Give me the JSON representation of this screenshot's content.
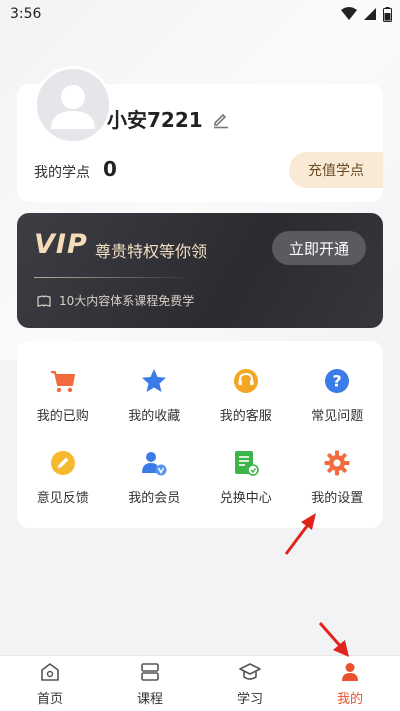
{
  "status_bar": {
    "time": "3:56"
  },
  "profile": {
    "username": "小安7221",
    "points_label": "我的学点",
    "points_value": "0",
    "recharge_label": "充值学点"
  },
  "vip": {
    "logo": "VIP",
    "title": "尊贵特权等你领",
    "subtitle": "10大内容体系课程免费学",
    "button_label": "立即开通"
  },
  "menu": {
    "items": [
      {
        "label": "我的已购",
        "icon": "cart-icon",
        "color": "#f26a3d"
      },
      {
        "label": "我的收藏",
        "icon": "star-icon",
        "color": "#3a7be8"
      },
      {
        "label": "我的客服",
        "icon": "headset-icon",
        "color": "#f5a623"
      },
      {
        "label": "常见问题",
        "icon": "question-icon",
        "color": "#3a7be8"
      },
      {
        "label": "意见反馈",
        "icon": "pencil-icon",
        "color": "#f5b82e"
      },
      {
        "label": "我的会员",
        "icon": "member-icon",
        "color": "#3a7be8"
      },
      {
        "label": "兑换中心",
        "icon": "redeem-icon",
        "color": "#3bb54a"
      },
      {
        "label": "我的设置",
        "icon": "gear-icon",
        "color": "#f26a3d"
      }
    ]
  },
  "tabbar": {
    "items": [
      {
        "label": "首页",
        "icon": "home-icon",
        "active": false
      },
      {
        "label": "课程",
        "icon": "course-icon",
        "active": false
      },
      {
        "label": "学习",
        "icon": "graduation-cap-icon",
        "active": false
      },
      {
        "label": "我的",
        "icon": "user-icon",
        "active": true
      }
    ]
  },
  "colors": {
    "accent": "#e8522c",
    "vip_gold": "#f4dcb8",
    "recharge_bg": "#f9ead6",
    "annotation_arrow": "#e0241c"
  }
}
